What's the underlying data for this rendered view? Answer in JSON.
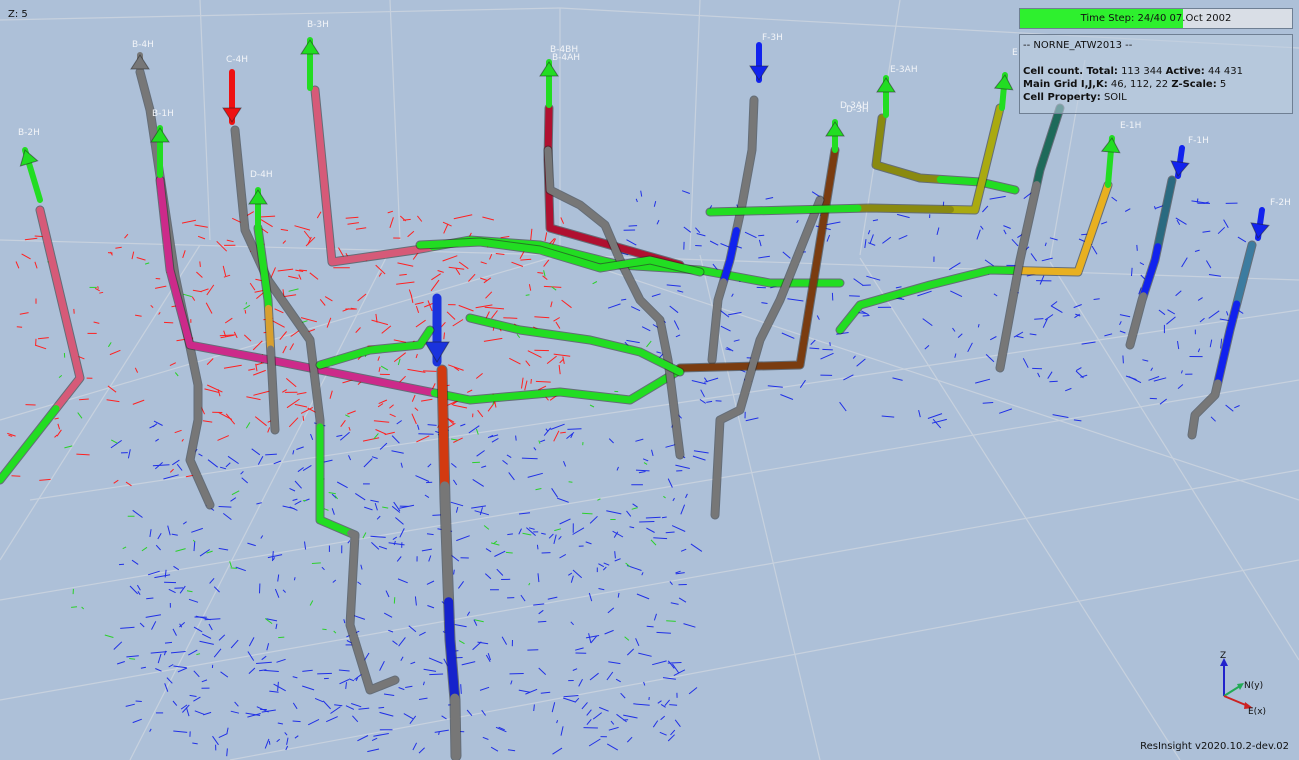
{
  "viewer": {
    "z_scale_label": "Z: 5",
    "version": "ResInsight v2020.10.2-dev.02"
  },
  "time_step": {
    "label": "Time Step: 24/40 07.Oct 2002",
    "current": 24,
    "total": 40
  },
  "info": {
    "title": "-- NORNE_ATW2013 --",
    "cell_count_label": "Cell count. Total:",
    "cell_count_total": "113 344",
    "active_label": "Active:",
    "active_count": "44 431",
    "grid_label": "Main Grid I,J,K:",
    "grid_value": "46, 112, 22",
    "zscale_label": "Z-Scale:",
    "zscale_value": "5",
    "property_label": "Cell Property:",
    "property_value": "SOIL"
  },
  "wells": [
    {
      "name": "B-2H"
    },
    {
      "name": "B-4H"
    },
    {
      "name": "B-1H"
    },
    {
      "name": "C-4H"
    },
    {
      "name": "D-4H"
    },
    {
      "name": "B-3H"
    },
    {
      "name": "B-4BH"
    },
    {
      "name": "B-4AH"
    },
    {
      "name": "F-3H"
    },
    {
      "name": "D-3AH"
    },
    {
      "name": "D-3H"
    },
    {
      "name": "E-3AH"
    },
    {
      "name": "E"
    },
    {
      "name": "E-1H"
    },
    {
      "name": "F-1H"
    },
    {
      "name": "F-2H"
    }
  ],
  "axes": {
    "z": "Z",
    "n": "N(y)",
    "e": "E(x)"
  },
  "colors": {
    "background": "#adc0d8",
    "producer": "#22dd22",
    "injector_gas": "#ee1111",
    "injector_water": "#1122ee",
    "well_grey": "#777777",
    "well_pink": "#d65a78",
    "well_magenta": "#cc2a8a"
  }
}
